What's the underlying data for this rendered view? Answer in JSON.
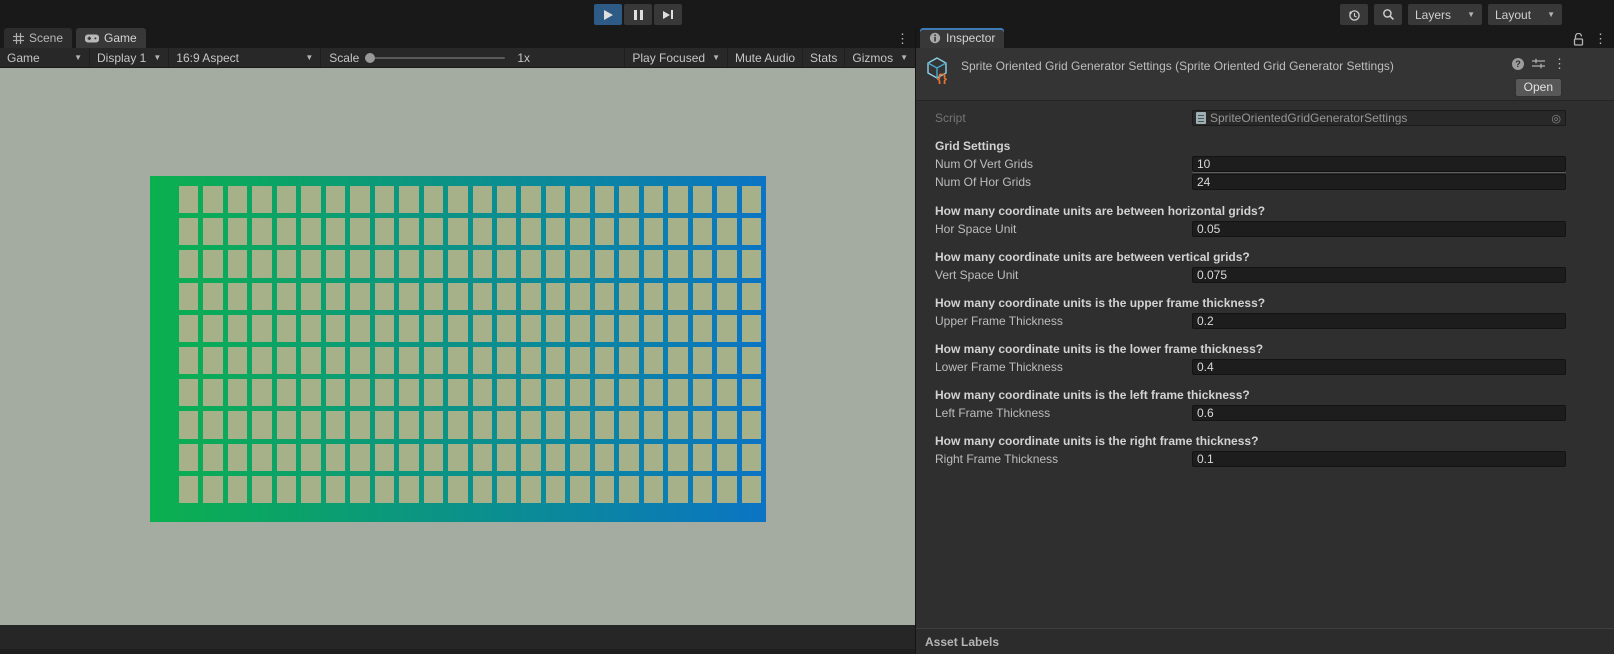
{
  "topbar": {
    "layers_label": "Layers",
    "layout_label": "Layout"
  },
  "game_panel": {
    "tabs": {
      "scene": "Scene",
      "game": "Game"
    },
    "toolbar": {
      "display_mode": "Game",
      "display_target": "Display 1",
      "aspect": "16:9 Aspect",
      "scale_label": "Scale",
      "scale_value": "1x",
      "play_focused": "Play Focused",
      "mute_audio": "Mute Audio",
      "stats": "Stats",
      "gizmos": "Gizmos"
    },
    "viewport": {
      "bg_color": "#a4aca1",
      "grid": {
        "columns": 24,
        "rows": 10,
        "frame_gradient_start": "#0bb04e",
        "frame_gradient_end": "#0b74c4",
        "cell_color": "#a6b18a"
      }
    }
  },
  "inspector": {
    "tab_label": "Inspector",
    "title": "Sprite Oriented Grid Generator Settings (Sprite Oriented Grid Generator Settings)",
    "open_button": "Open",
    "script_row": {
      "label": "Script",
      "value": "SpriteOrientedGridGeneratorSettings"
    },
    "grid_settings_header": "Grid Settings",
    "grid_fields": [
      {
        "label": "Num Of Vert Grids",
        "value": "10"
      },
      {
        "label": "Num Of Hor Grids",
        "value": "24"
      }
    ],
    "question_groups": [
      {
        "question": "How many coordinate units are between horizontal grids?",
        "label": "Hor Space Unit",
        "value": "0.05"
      },
      {
        "question": "How many coordinate units are between vertical grids?",
        "label": "Vert Space Unit",
        "value": "0.075"
      },
      {
        "question": "How many coordinate units is the upper frame thickness?",
        "label": "Upper Frame Thickness",
        "value": "0.2"
      },
      {
        "question": "How many coordinate units is the lower frame thickness?",
        "label": "Lower Frame Thickness",
        "value": "0.4"
      },
      {
        "question": "How many coordinate units is the left frame thickness?",
        "label": "Left Frame Thickness",
        "value": "0.6"
      },
      {
        "question": "How many coordinate units is the right frame thickness?",
        "label": "Right Frame Thickness",
        "value": "0.1"
      }
    ],
    "asset_labels_header": "Asset Labels"
  },
  "colors": {
    "focused_tab_accent": "#3e7cb8",
    "active_play_button": "#2d5b85"
  }
}
